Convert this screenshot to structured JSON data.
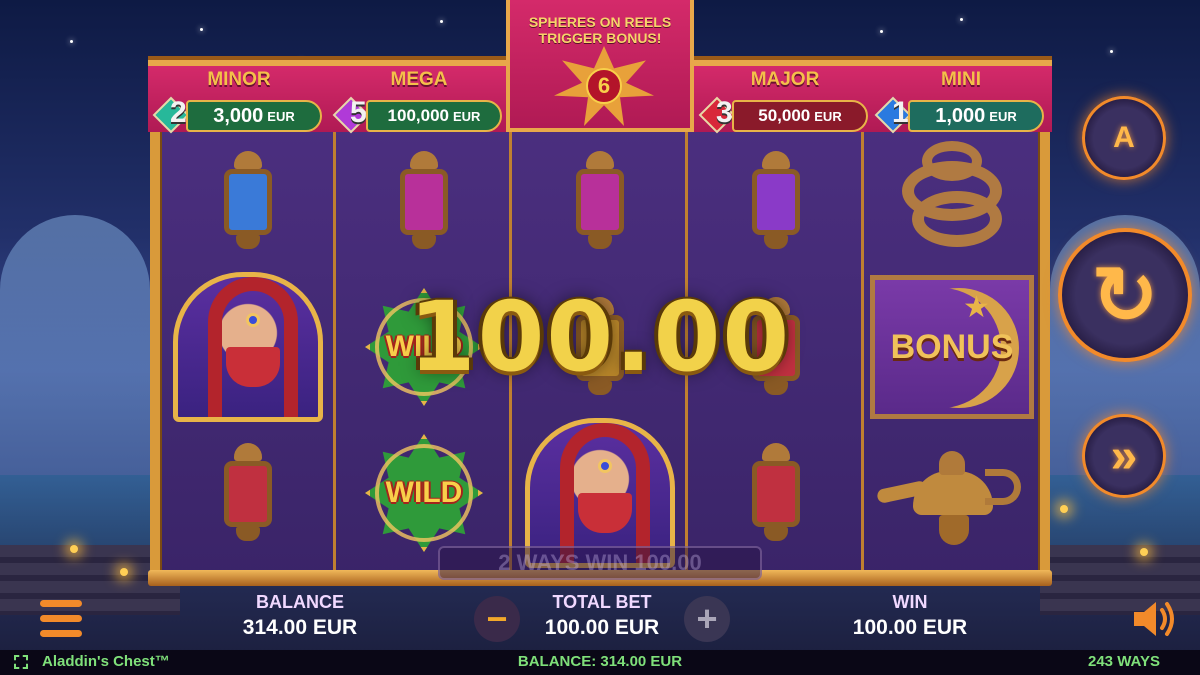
{
  "game": {
    "title": "Aladdin's Chest™",
    "ways_label": "243 WAYS",
    "bottom_balance_label": "BALANCE: 314.00 EUR"
  },
  "jackpots": [
    {
      "name": "MINOR",
      "count": "2",
      "value": "3,000",
      "currency": "EUR",
      "gem_color": "#27b89a"
    },
    {
      "name": "MEGA",
      "count": "5",
      "value": "100,000",
      "currency": "EUR",
      "gem_color": "#b03ad8"
    },
    {
      "name": "MAJOR",
      "count": "3",
      "value": "50,000",
      "currency": "EUR",
      "gem_color": "#d8283a"
    },
    {
      "name": "MINI",
      "count": "1",
      "value": "1,000",
      "currency": "EUR",
      "gem_color": "#2a7ae0"
    }
  ],
  "trigger": {
    "line1": "SPHERES ON REELS",
    "line2": "TRIGGER BONUS!",
    "count": "6"
  },
  "reels": [
    [
      "lantern-blue",
      "woman",
      "lantern-red"
    ],
    [
      "lantern-pink",
      "wild",
      "wild"
    ],
    [
      "lantern-pink",
      "lantern-gold",
      "woman"
    ],
    [
      "lantern-purple",
      "lantern-red",
      "lantern-red"
    ],
    [
      "snake",
      "bonus",
      "lamp"
    ]
  ],
  "symbols": {
    "wild_label": "WILD",
    "bonus_label": "BONUS"
  },
  "win_display": {
    "amount": "100.00",
    "ways_win": "2 WAYS WIN 100.00"
  },
  "stats": {
    "balance_label": "BALANCE",
    "balance_value": "314.00 EUR",
    "total_bet_label": "TOTAL BET",
    "total_bet_value": "100.00 EUR",
    "win_label": "WIN",
    "win_value": "100.00 EUR"
  },
  "controls": {
    "decrease_glyph": "−",
    "increase_glyph": "+",
    "autoplay_glyph": "A",
    "spin_glyph": "↻",
    "turbo_glyph": "»"
  },
  "colors": {
    "jackpot_panel": "#c8205e",
    "frame_gold": "#d99a3a",
    "accent_orange": "#f28a2a",
    "reel_bg": "#4b2f7f",
    "status_green": "#7fe07a"
  }
}
